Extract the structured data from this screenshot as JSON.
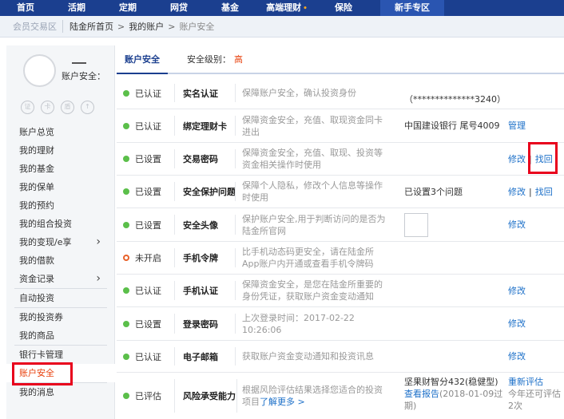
{
  "topnav": {
    "items": [
      "首页",
      "活期",
      "定期",
      "网贷",
      "基金",
      "高端理财",
      "保险"
    ],
    "zone": "新手专区"
  },
  "crumbs": {
    "zone_label": "会员交易区",
    "items": [
      "陆金所首页",
      "我的账户",
      "账户安全"
    ],
    "arrow": ">"
  },
  "sidebar": {
    "user_label": "账户安全：",
    "menu": [
      "账户总览",
      "我的理财",
      "我的基金",
      "我的保单",
      "我的预约",
      "我的组合投资",
      "我的变现/e享",
      "我的借款",
      "资金记录",
      "自动投资",
      "我的投资券",
      "我的商品",
      "银行卡管理",
      "账户安全",
      "我的消息"
    ],
    "chevron": "›"
  },
  "tab": {
    "label": "账户安全",
    "level_label": "安全级别：",
    "level_value": "高"
  },
  "rows": [
    {
      "status": "已认证",
      "name": "实名认证",
      "desc": "保障账户安全，确认投资身份",
      "info": "（**************3240）",
      "ops": []
    },
    {
      "status": "已认证",
      "name": "绑定理财卡",
      "desc": "保障资金安全，充值、取现资金同卡进出",
      "info": "中国建设银行 尾号4009",
      "ops": [
        "管理"
      ]
    },
    {
      "status": "已设置",
      "name": "交易密码",
      "desc": "保障资金安全，充值、取现、投资等资金相关操作时使用",
      "info": "",
      "ops": [
        "修改",
        "找回"
      ]
    },
    {
      "status": "已设置",
      "name": "安全保护问题",
      "desc": "保障个人隐私，修改个人信息等操作时使用",
      "info": "已设置3个问题",
      "ops": [
        "修改",
        "找回"
      ]
    },
    {
      "status": "已设置",
      "name": "安全头像",
      "desc": "保护账户安全,用于判断访问的是否为陆金所官网",
      "info": "",
      "ops": [
        "修改"
      ]
    },
    {
      "status": "未开启",
      "name": "手机令牌",
      "desc": "比手机动态码更安全，请在陆金所App账户内开通或查看手机令牌码",
      "info": "",
      "ops": []
    },
    {
      "status": "已认证",
      "name": "手机认证",
      "desc": "保障资金安全，是您在陆金所重要的身份凭证，获取账户资金变动通知",
      "info": "",
      "ops": [
        "修改"
      ]
    },
    {
      "status": "已设置",
      "name": "登录密码",
      "desc": "上次登录时间：2017-02-22 10:26:06",
      "info": "",
      "ops": [
        "修改"
      ]
    },
    {
      "status": "已认证",
      "name": "电子邮箱",
      "desc": "获取账户资金变动通知和投资讯息",
      "info": "",
      "ops": [
        "修改"
      ]
    },
    {
      "status": "已评估",
      "name": "风险承受能力",
      "desc": "根据风险评估结果选择您适合的投资项目",
      "desc_link": "了解更多 >",
      "info": "坚果财智分432(稳健型)",
      "info_link": "查看报告",
      "info_tail": "(2018-01-09过期)",
      "ops": [
        "重新评估"
      ],
      "ops_note": "今年还可评估2次"
    }
  ],
  "colors": {
    "brand": "#1b3f8f",
    "link": "#1b6fc8",
    "accent": "#e8400c",
    "ok": "#5bbf4a",
    "highlight": "#e8001c"
  }
}
